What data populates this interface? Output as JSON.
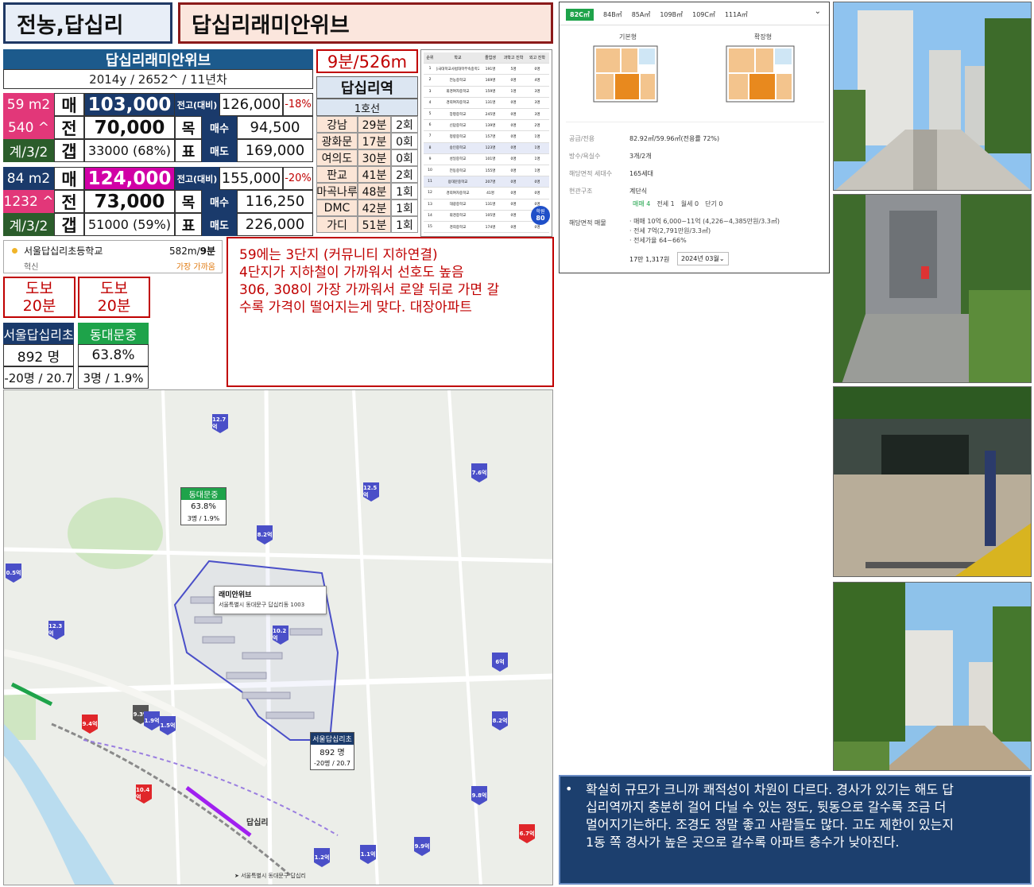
{
  "header": {
    "region": "전농,답십리",
    "complex": "답십리래미안위브"
  },
  "apt": {
    "name": "답십리래미안위브",
    "info": "2014y / 2652^ / 11년차",
    "walk_time": "9분/526m"
  },
  "size59": {
    "area": "59 m2",
    "units": "540 ^",
    "type": "계/3/2",
    "sale_label": "매",
    "sale": "103,000",
    "jeonse_label": "전",
    "jeonse": "70,000",
    "gap_label": "갭",
    "gap": "33000 (68%)",
    "peak_label": "전고(대비)",
    "peak": "126,000",
    "peak_pct": "-18%",
    "target_label1": "목",
    "target_label2": "표",
    "buy_label": "매수",
    "buy": "94,500",
    "sell_label": "매도",
    "sell": "169,000"
  },
  "size84": {
    "area": "84 m2",
    "units": "1232 ^",
    "type": "계/3/2",
    "sale_label": "매",
    "sale": "124,000",
    "jeonse_label": "전",
    "jeonse": "73,000",
    "gap_label": "갭",
    "gap": "51000 (59%)",
    "peak_label": "전고(대비)",
    "peak": "155,000",
    "peak_pct": "-20%",
    "target_label1": "목",
    "target_label2": "표",
    "buy_label": "매수",
    "buy": "116,250",
    "sell_label": "매도",
    "sell": "226,000"
  },
  "station": {
    "name": "답십리역",
    "line": "1호선",
    "rows": [
      {
        "dest": "강남",
        "time": "29분",
        "transfer": "2회"
      },
      {
        "dest": "광화문",
        "time": "17분",
        "transfer": "0회"
      },
      {
        "dest": "여의도",
        "time": "30분",
        "transfer": "0회"
      },
      {
        "dest": "판교",
        "time": "41분",
        "transfer": "2회"
      },
      {
        "dest": "마곡나루",
        "time": "48분",
        "transfer": "1회"
      },
      {
        "dest": "DMC",
        "time": "42분",
        "transfer": "1회"
      },
      {
        "dest": "가디",
        "time": "51분",
        "transfer": "1회"
      }
    ]
  },
  "school_table": {
    "headers": [
      "순위",
      "학교",
      "졸업생",
      "과학고 진학",
      "외고 진학"
    ],
    "rows": [
      [
        "1",
        "동국대학교사범대학부속중학교",
        "191명",
        "5명",
        "0명"
      ],
      [
        "2",
        "전농중학교",
        "169명",
        "0명",
        "4명"
      ],
      [
        "3",
        "휘경여자중학교",
        "159명",
        "1명",
        "3명"
      ],
      [
        "4",
        "경희여자중학교",
        "131명",
        "0명",
        "3명"
      ],
      [
        "5",
        "장평중학교",
        "245명",
        "0명",
        "3명"
      ],
      [
        "6",
        "신답중학교",
        "139명",
        "0명",
        "2명"
      ],
      [
        "7",
        "청량중학교",
        "157명",
        "0명",
        "1명"
      ],
      [
        "8",
        "숭인중학교",
        "123명",
        "0명",
        "1명"
      ],
      [
        "9",
        "성일중학교",
        "101명",
        "0명",
        "1명"
      ],
      [
        "10",
        "전동중학교",
        "155명",
        "0명",
        "1명"
      ],
      [
        "11",
        "용대문중학교",
        "207명",
        "0명",
        "0명"
      ],
      [
        "12",
        "경희여자중학교",
        "41명",
        "0명",
        "0명"
      ],
      [
        "13",
        "대광중학교",
        "131명",
        "0명",
        "0명"
      ],
      [
        "14",
        "휘경중학교",
        "105명",
        "0명",
        "0명"
      ],
      [
        "15",
        "경희중학교",
        "174명",
        "0명",
        "0명"
      ]
    ],
    "badge_top": "학원",
    "badge_num": "80"
  },
  "school": {
    "name": "서울답십리초등학교",
    "distance_prefix": "582m/",
    "distance_time": "9분",
    "tag": "혁신",
    "note": "가장 가까움"
  },
  "walk": [
    {
      "l1": "도보",
      "l2": "20분"
    },
    {
      "l1": "도보",
      "l2": "20분"
    }
  ],
  "elem": {
    "name": "서울답십리초",
    "students": "892 명",
    "stats": "-20명 / 20.7"
  },
  "middle": {
    "name": "동대문중",
    "rate": "63.8%",
    "stats": "3명 / 1.9%"
  },
  "memo": {
    "lines": [
      "59에는 3단지 (커뮤니티 지하연결)",
      "4단지가 지하철이 가까워서 선호도 높음",
      "306, 308이 가장 가까워서 로얄 뒤로 가면 갈",
      "수록 가격이 떨어지는게 맞다. 대장아파트"
    ]
  },
  "floorplan": {
    "tabs": [
      "82C㎡",
      "84B㎡",
      "85A㎡",
      "109B㎡",
      "109C㎡",
      "111A㎡"
    ],
    "plan_labels": [
      "기본형",
      "확장형"
    ],
    "rows": [
      {
        "k": "공급/전용",
        "v": "82.92㎡/59.96㎡(전용률 72%)"
      },
      {
        "k": "방수/욕실수",
        "v": "3개/2개"
      },
      {
        "k": "해당면적 세대수",
        "v": "165세대"
      },
      {
        "k": "현관구조",
        "v": "계단식"
      }
    ],
    "counts": [
      "매매 4",
      "전세 1",
      "월세 0",
      "단기 0"
    ],
    "listing_label": "해당면적 매물",
    "listings": [
      "· 매매 10억 6,000~11억 (4,226~4,385만원/3.3㎡)",
      "· 전세 7억(2,791만원/3.3㎡)",
      "· 전세가율 64~66%"
    ],
    "trade_count": "17만 1,317원",
    "trade_date": "2024년 03월"
  },
  "map": {
    "middle_name": "동대문중",
    "middle_rate": "63.8%",
    "middle_stats": "3명 / 1.9%",
    "elem_name": "서울답십리초",
    "elem_students": "892 명",
    "elem_stats": "-20명 / 20.7",
    "popup_title": "래미안위브",
    "popup_addr": "서울특별시 동대문구 답십리동 1003",
    "station_label": "답십리",
    "footer_addr": "서울특별시 동대문구 답십리",
    "pins": [
      "12.7억",
      "7.6억",
      "12.5억",
      "8.2억",
      "0.5억",
      "12.3억",
      "10.2억",
      "6억",
      "9.3억",
      "9.4억",
      "1.9억",
      "1.5억",
      "8.2억",
      "10.4억",
      "9.8억",
      "6.7억",
      "1.2억",
      "1.1억",
      "9.9억"
    ]
  },
  "comment": {
    "bullet": "•",
    "lines": [
      "확실히 규모가 크니까 쾌적성이 차원이 다르다. 경사가 있기는 해도 답",
      "십리역까지 충분히 걸어 다닐 수 있는 정도, 뒷동으로 갈수록 조금 더",
      "멀어지기는하다. 조경도 정말 좋고 사람들도 많다. 고도 제한이 있는지",
      "1동 쪽 경사가 높은 곳으로 갈수록 아파트 층수가 낮아진다."
    ]
  },
  "colors": {
    "navy": "#1f3864",
    "pink": "#e23779",
    "magenta": "#d100a6",
    "red": "#c00000",
    "green": "#1ea34a"
  }
}
